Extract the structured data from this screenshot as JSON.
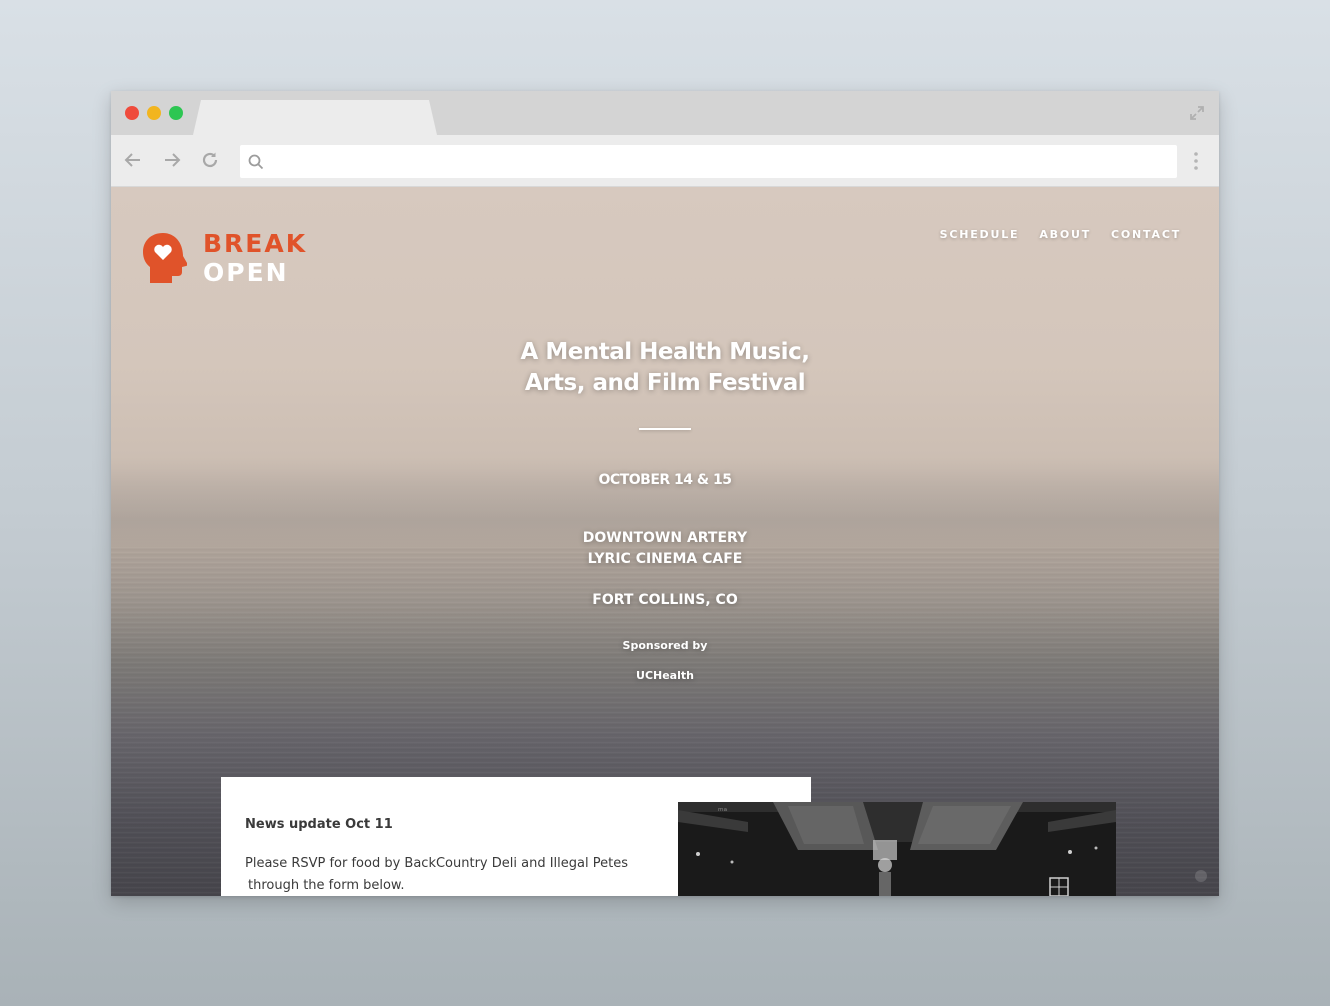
{
  "browser": {
    "tab_title": "",
    "url": ""
  },
  "site": {
    "logo": {
      "line1": "BREAK",
      "line2": "OPEN"
    },
    "nav": [
      {
        "label": "SCHEDULE"
      },
      {
        "label": "ABOUT"
      },
      {
        "label": "CONTACT"
      }
    ],
    "hero": {
      "headline_line1": "A Mental Health Music,",
      "headline_line2": "Arts, and Film Festival",
      "dates": "OCTOBER 14 & 15",
      "venue_line1": "DOWNTOWN ARTERY",
      "venue_line2": "LYRIC CINEMA CAFE",
      "city": "FORT COLLINS, CO",
      "sponsored_label": "Sponsored by",
      "sponsor": "UCHealth"
    },
    "news": {
      "title": "News update Oct 11",
      "body_line1": "Please RSVP for food by BackCountry Deli and Illegal Petes",
      "body_line2": "through the form below."
    }
  },
  "colors": {
    "brand_orange": "#e0532a",
    "close_dot": "#ef4b3c",
    "minimize_dot": "#f2b51f",
    "maximize_dot": "#2dc652"
  },
  "icons": [
    "back-arrow-icon",
    "forward-arrow-icon",
    "reload-icon",
    "search-icon",
    "more-options-icon",
    "expand-icon",
    "head-heart-logo-icon"
  ]
}
